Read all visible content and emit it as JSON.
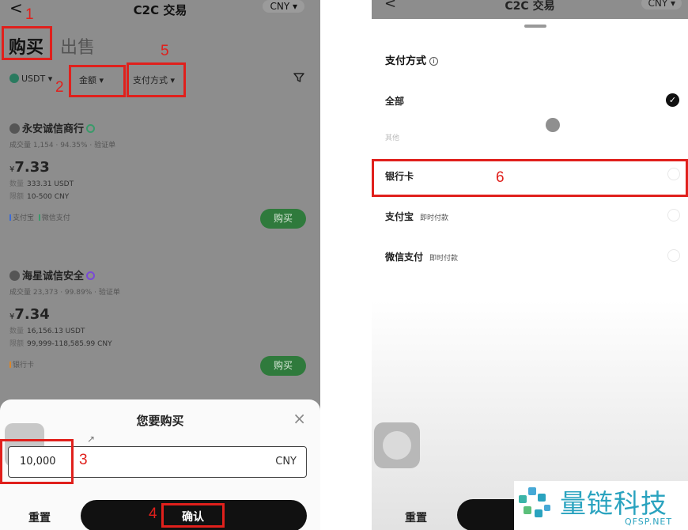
{
  "left": {
    "header": {
      "back": "<",
      "title": "C2C 交易",
      "currency": "CNY ▾"
    },
    "tabs": {
      "buy": "购买",
      "sell": "出售"
    },
    "filters": {
      "coin": "USDT ▾",
      "amount": "金额 ▾",
      "payment": "支付方式 ▾",
      "filter_icon": "funnel-icon"
    },
    "merchants": [
      {
        "name": "永安诚信商行",
        "stats": "成交量 1,154 · 94.35% · 验证单",
        "currency_symbol": "¥",
        "price": "7.33",
        "qty_label": "数量",
        "qty": "333.31 USDT",
        "limit_label": "限额",
        "limit": "10-500 CNY",
        "payments": [
          "支付宝",
          "微信支付"
        ],
        "buy_label": "购买"
      },
      {
        "name": "海星诚信安全",
        "stats": "成交量 23,373 · 99.89% · 验证单",
        "currency_symbol": "¥",
        "price": "7.34",
        "qty_label": "数量",
        "qty": "16,156.13 USDT",
        "limit_label": "限额",
        "limit": "99,999-118,585.99 CNY",
        "payments": [
          "银行卡"
        ],
        "buy_label": "购买"
      }
    ],
    "sheet": {
      "title": "您要购买",
      "close": "×",
      "amount_value": "10,000",
      "amount_unit": "CNY",
      "reset": "重置",
      "confirm": "确认"
    }
  },
  "right": {
    "header": {
      "back": "<",
      "title": "C2C 交易",
      "currency": "CNY ▾"
    },
    "sheet": {
      "title": "支付方式",
      "info": "i",
      "options": [
        {
          "label": "全部",
          "tag": "",
          "selected": true
        },
        {
          "label": "银行卡",
          "tag": "",
          "selected": false
        },
        {
          "label": "支付宝",
          "tag": "即时付款",
          "selected": false
        },
        {
          "label": "微信支付",
          "tag": "即时付款",
          "selected": false
        }
      ],
      "other": "其他",
      "reset": "重置"
    }
  },
  "annotations": [
    "1",
    "2",
    "3",
    "4",
    "5",
    "6"
  ],
  "watermark": {
    "cn": "量链科技",
    "en": "QFSP.NET"
  },
  "colors": {
    "annotation": "#e0201c",
    "buy_button": "#2f7a3c",
    "watermark": "#2aa3bf"
  }
}
